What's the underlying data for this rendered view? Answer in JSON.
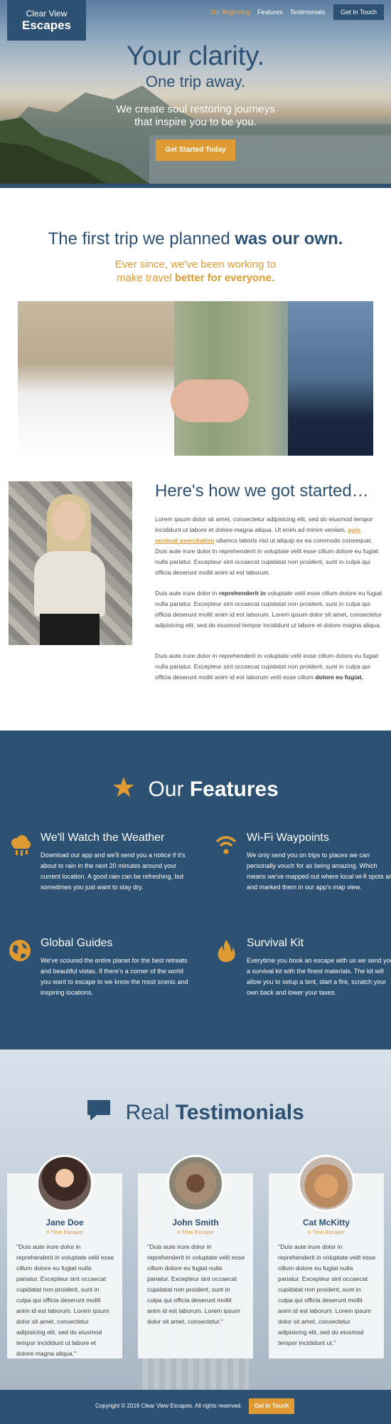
{
  "brand": {
    "line1": "Clear View",
    "line2": "Escapes"
  },
  "nav": {
    "items": [
      "Our Beginning",
      "Features",
      "Testimonials"
    ],
    "cta": "Get In Touch"
  },
  "hero": {
    "title": "Your clarity.",
    "subtitle": "One trip away.",
    "tagline_1": "We create soul restoring journeys",
    "tagline_2": "that inspire you to be you.",
    "button": "Get Started Today"
  },
  "beginning": {
    "title_light": "The first trip we planned",
    "title_bold": "was our own.",
    "sub_line1": "Ever since, we've been working to",
    "sub_line2_light": "make travel",
    "sub_line2_bold": "better for everyone."
  },
  "story": {
    "title": "Here's how we got started…",
    "p1_a": "Lorem ipsum dolor sit amet, consectetur adipisicing elit, sed do eiusmod tempor incididunt ut labore et dolore magna aliqua. Ut enim ad minim veniam,",
    "p1_link": "quis nostrud exercitation",
    "p1_b": "ullamco laboris nisi ut aliquip ex ea commodo consequat. Duis aute irure dolor in reprehenderit in voluptate velit esse cillum dolore eu fugiat nulla pariatur. Excepteur sint occaecat cupidatat non proident, sunt in culpa qui officia deserunt mollit anim id est laborum.",
    "p2_a": "Duis aute irure dolor in",
    "p2_bold": "reprehenderit in",
    "p2_b": "voluptate velit esse cillum dolore eu fugiat nulla pariatur. Excepteur sint occaecat cupidatat non proident, sunt in culpa qui officia deserunt mollit anim id est laborum. Lorem ipsum dolor sit amet, consectetur adipisicing elit, sed do eiusmod tempor incididunt ut labore et dolore magna aliqua.",
    "p3_a": "Duis aute irure dolor in reprehenderit in voluptate velit esse cillum dolore eu fugiat nulla pariatur. Excepteur sint occaecat cupidatat non proident, sunt in culpa qui officia deserunt mollit anim id est laborum velit esse cillum",
    "p3_bold": "dolore eu fugiat."
  },
  "features": {
    "title_light": "Our",
    "title_bold": "Features",
    "items": [
      {
        "icon": "cloud-rain-icon",
        "title": "We'll Watch the Weather",
        "text": "Download our app and we'll send you a notice if it's about to rain in the next 20 minutes around your current location. A good rain can be refreshing, but sometimes you just want to stay dry."
      },
      {
        "icon": "wifi-icon",
        "title": "Wi-Fi Waypoints",
        "text": "We only send you on trips to places we can personally vouch for as being amazing. Which means we've mapped out where local wi-fi spots are and marked them in our app's map view."
      },
      {
        "icon": "globe-icon",
        "title": "Global Guides",
        "text": "We've scoured the entire planet for the best retreats and beautiful vistas. If there's a corner of the world you want to escape to we know the most scenic and inspiring locations."
      },
      {
        "icon": "fire-icon",
        "title": "Survival Kit",
        "text": "Everytime you book an escape with us we send you a survival kit with the finest materials. The kit will allow you to setup a tent, start a fire, scratch your own back and lower your taxes."
      }
    ]
  },
  "testimonials": {
    "title_light": "Real",
    "title_bold": "Testimonials",
    "items": [
      {
        "name": "Jane Doe",
        "role": "9 Time Escaper",
        "quote": "\"Duis aute irure dolor in reprehenderit in voluptate velit esse cillum dolore eu fugiat nulla pariatur. Excepteur sint occaecat cupidatat non proident, sunt in culpa qui officia deserunt mollit anim id est laborum. Lorem ipsum dolor sit amet, consectetur adipisicing elit, sed do eiusmod tempor incididunt ut labore et dolore magna aliqua.\""
      },
      {
        "name": "John Smith",
        "role": "4 Time Escaper",
        "quote": "\"Duis aute irure dolor in reprehenderit in voluptate velit esse cillum dolore eu fugiat nulla pariatur. Excepteur sint occaecat cupidatat non proident, sunt in culpa qui officia deserunt mollit anim id est laborum. Lorem ipsum dolor sit amet, consectetur.\""
      },
      {
        "name": "Cat McKitty",
        "role": "6 Time Escaper",
        "quote": "\"Duis aute irure dolor in reprehenderit in voluptate velit esse cillum dolore eu fugiat nulla pariatur. Excepteur sint occaecat cupidatat non proident, sunt in culpa qui officia deserunt mollit anim id est laborum. Lorem ipsum dolor sit amet, consectetur adipisicing elit, sed do eiusmod tempor incididunt ut.\""
      }
    ]
  },
  "footer": {
    "copyright": "Copyright © 2016 Clear View Escapes. All rights reserved.",
    "cta": "Get In Touch"
  },
  "colors": {
    "primary": "#2c5173",
    "accent": "#e09a32"
  }
}
